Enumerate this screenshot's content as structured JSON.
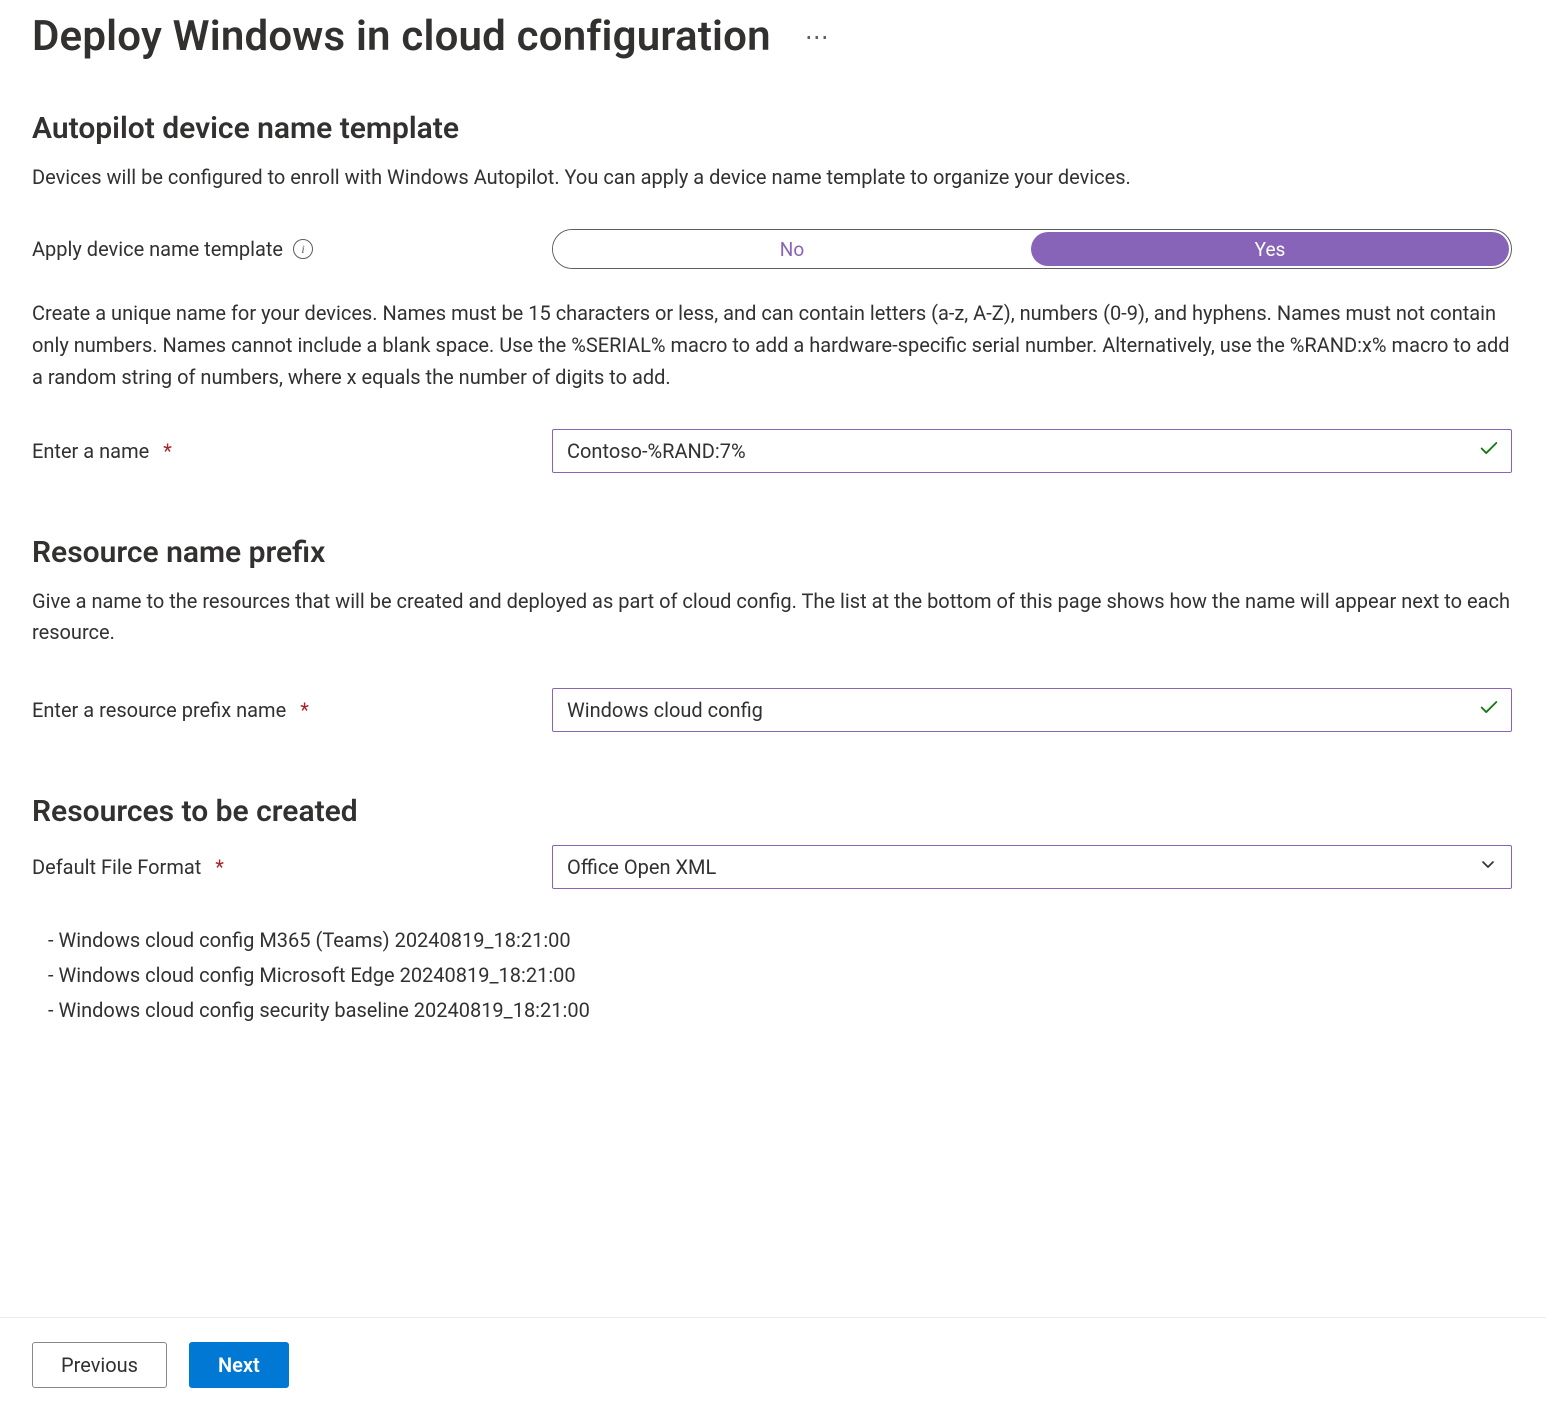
{
  "header": {
    "title": "Deploy Windows in cloud configuration"
  },
  "autopilot": {
    "heading": "Autopilot device name template",
    "description": "Devices will be configured to enroll with Windows Autopilot. You can apply a device name template to organize your devices.",
    "toggle_label": "Apply device name template",
    "toggle_options": {
      "no": "No",
      "yes": "Yes"
    },
    "helper": "Create a unique name for your devices. Names must be 15 characters or less, and can contain letters (a-z, A-Z), numbers (0-9), and hyphens. Names must not contain only numbers. Names cannot include a blank space. Use the %SERIAL% macro to add a hardware-specific serial number. Alternatively, use the %RAND:x% macro to add a random string of numbers, where x equals the number of digits to add.",
    "name_label": "Enter a name",
    "name_value": "Contoso-%RAND:7%"
  },
  "resource_prefix": {
    "heading": "Resource name prefix",
    "description": "Give a name to the resources that will be created and deployed as part of cloud config. The list at the bottom of this page shows how the name will appear next to each resource.",
    "label": "Enter a resource prefix name",
    "value": "Windows cloud config"
  },
  "resources": {
    "heading": "Resources to be created",
    "format_label": "Default File Format",
    "format_value": "Office Open XML",
    "items": [
      "Windows cloud config M365 (Teams) 20240819_18:21:00",
      "Windows cloud config Microsoft Edge 20240819_18:21:00",
      "Windows cloud config security baseline 20240819_18:21:00"
    ]
  },
  "footer": {
    "previous": "Previous",
    "next": "Next"
  }
}
